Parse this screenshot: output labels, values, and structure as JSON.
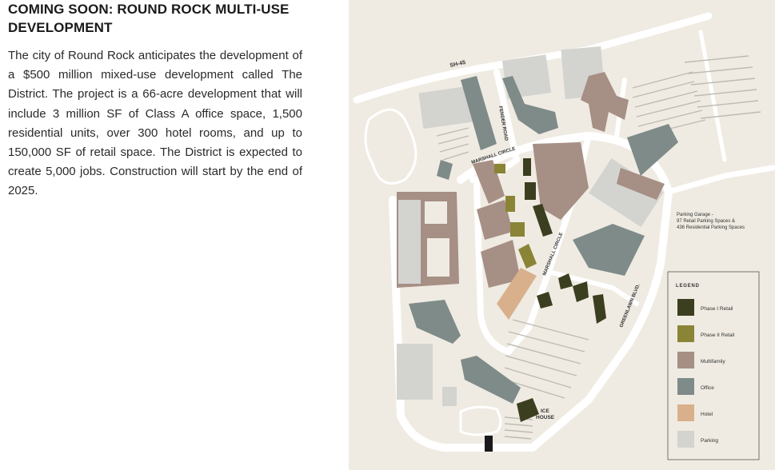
{
  "article": {
    "title": "COMING SOON: ROUND ROCK MULTI-USE DEVELOPMENT",
    "description": "The city of Round Rock anticipates the development of a $500 million mixed-use development called The District. The project is a 66-acre development that will include 3 million SF of Class A office space, 1,500 residential units, over 300 hotel rooms, and up to 150,000 SF of retail space. The District is expected to create 5,000 jobs. Construction will start by the end of 2025."
  },
  "map": {
    "roads": {
      "sh45": "SH-45",
      "fender": "FENDER ROAD",
      "marshall_top": "MARSHALL CIRCLE",
      "marshall_mid": "MARSHALL CIRCLE",
      "greenlawn": "GREENLAWN BLVD."
    },
    "ice_house": [
      "ICE",
      "HOUSE"
    ],
    "garage_note": [
      "Parking Garage -",
      "97 Retail Parking Spaces &",
      "436 Residential Parking Spaces"
    ],
    "legend": {
      "title": "LEGEND",
      "items": [
        {
          "label": "Phase I Retail",
          "color": "#3b3f1f"
        },
        {
          "label": "Phase II Retail",
          "color": "#8a8436"
        },
        {
          "label": "Multifamily",
          "color": "#a68f85"
        },
        {
          "label": "Office",
          "color": "#7e8b89"
        },
        {
          "label": "Hotel",
          "color": "#d9b08c"
        },
        {
          "label": "Parking",
          "color": "#d3d3d0"
        }
      ]
    },
    "colors": {
      "background": "#efebe2",
      "road": "#ffffff",
      "phase1": "#3b3f1f",
      "phase2": "#8a8436",
      "multifamily": "#a68f85",
      "office": "#7e8b89",
      "hotel": "#d9b08c",
      "parking": "#d3d3d0"
    }
  }
}
